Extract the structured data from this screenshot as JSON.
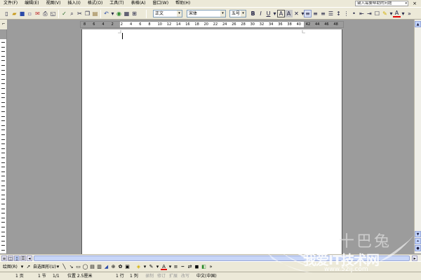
{
  "menubar": {
    "items": [
      "文件(F)",
      "编辑(E)",
      "视图(V)",
      "插入(I)",
      "格式(O)",
      "工具(T)",
      "表格(A)",
      "窗口(W)",
      "帮助(H)"
    ],
    "help_placeholder": "键入需要帮助的问题",
    "close_glyph": "×"
  },
  "toolbar": {
    "style_value": "正文",
    "font_value": "宋体",
    "size_value": "五号",
    "bold": "B",
    "italic": "I",
    "underline": "U",
    "font_color": "A"
  },
  "ruler": {
    "labels": [
      "8",
      "6",
      "4",
      "2",
      "2",
      "4",
      "6",
      "8",
      "10",
      "12",
      "14",
      "16",
      "18",
      "20",
      "22",
      "24",
      "26",
      "28",
      "30",
      "32",
      "34",
      "36",
      "38",
      "40",
      "42",
      "44",
      "46",
      "48"
    ]
  },
  "drawbar": {
    "draw_label": "绘图(R)",
    "autoshapes_label": "自选图形(U)"
  },
  "statusbar": {
    "page": "1 页",
    "section": "1 节",
    "page_of": "1/1",
    "position": "位置 2.5厘米",
    "line": "1 行",
    "column": "1 列",
    "rec": "录制",
    "trk": "修订",
    "ext": "扩展",
    "ovr": "改写",
    "language": "中文(中国)"
  },
  "watermark": {
    "brand_chars": "十巴兔",
    "title": "我爱IT技术网",
    "url": "www.52ij.com"
  }
}
